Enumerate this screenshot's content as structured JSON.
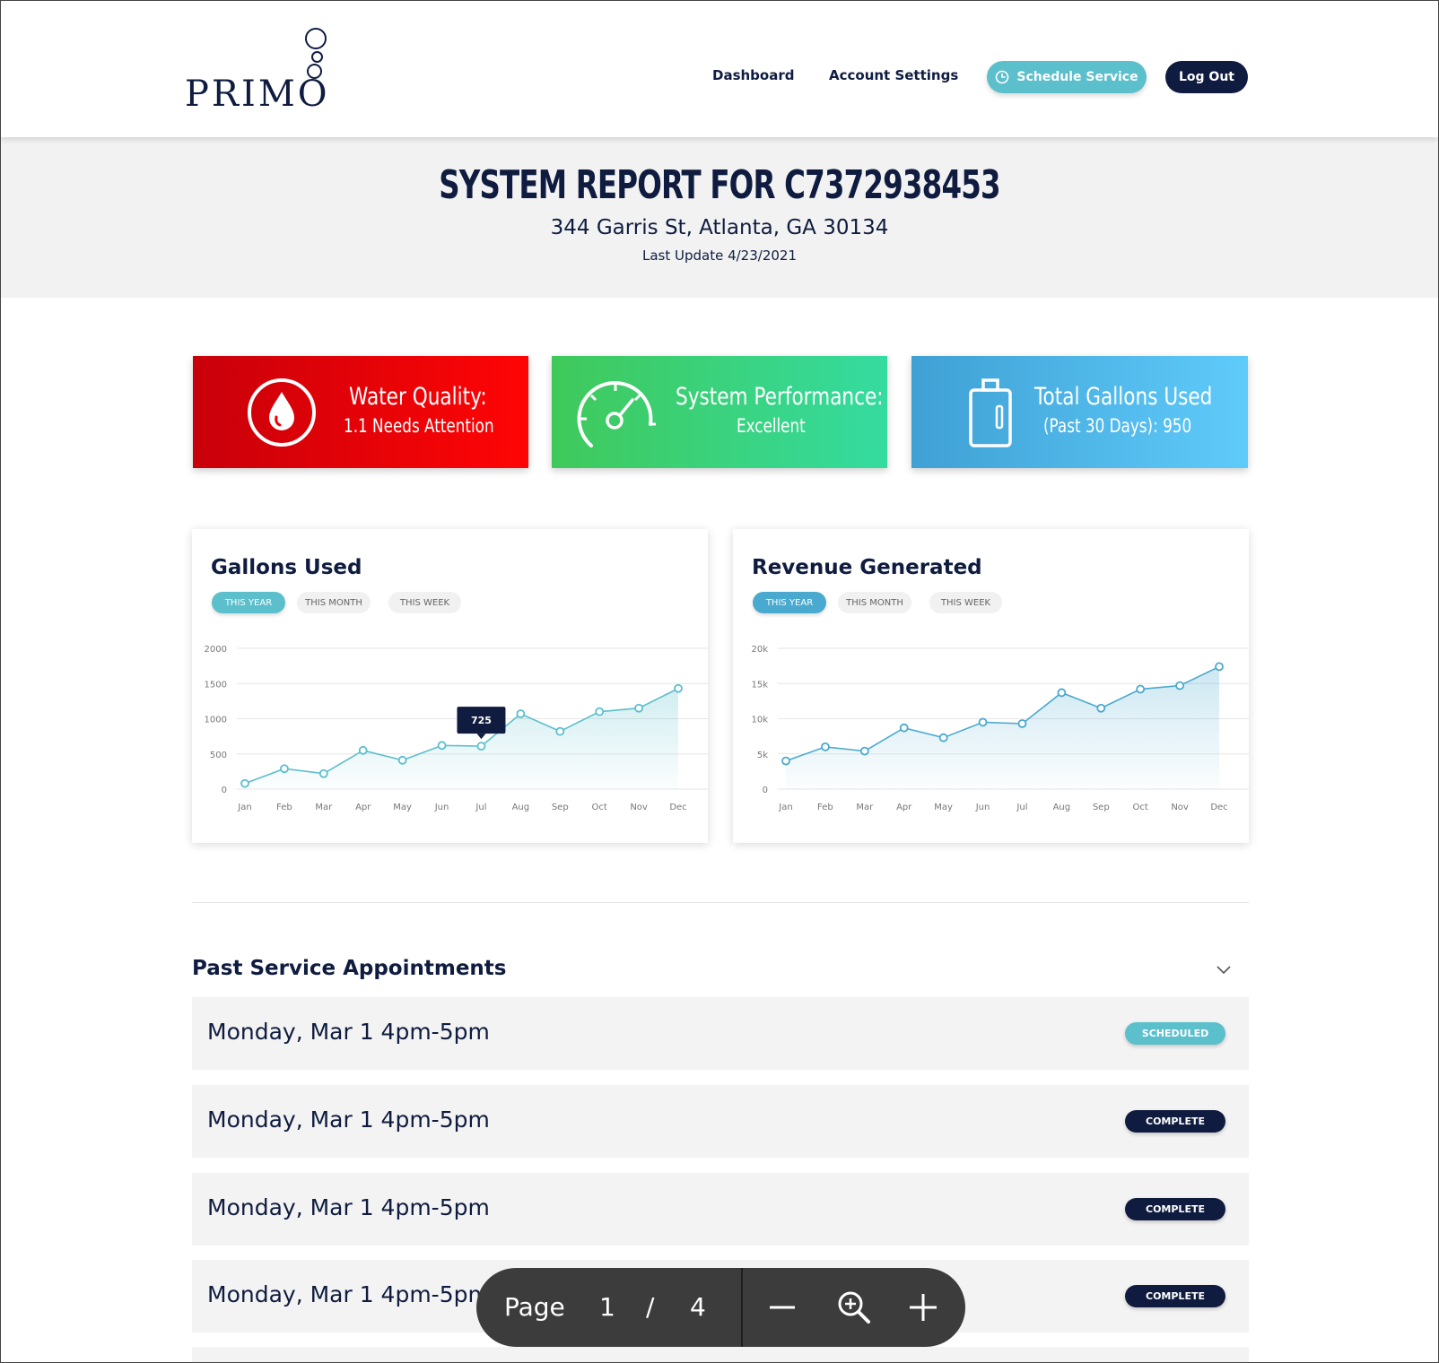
{
  "header": {
    "logo_text": "PRIMO",
    "nav": [
      "Dashboard",
      "Account Settings"
    ],
    "schedule_label": "Schedule Service",
    "logout_label": "Log Out"
  },
  "hero": {
    "title": "SYSTEM REPORT FOR C7372938453",
    "address": "344 Garris St, Atlanta, GA 30134",
    "last_update": "Last Update 4/23/2021"
  },
  "stats": [
    {
      "icon": "water-drop-icon",
      "title": "Water Quality:",
      "value": "1.1 Needs Attention",
      "color_start": "#c8000a",
      "color_end": "#ff0505"
    },
    {
      "icon": "speedometer-icon",
      "title": "System Performance:",
      "value": "Excellent",
      "color_start": "#3fc95a",
      "color_end": "#35dba0"
    },
    {
      "icon": "water-jug-icon",
      "title": "Total Gallons Used",
      "value": "(Past 30 Days): 950",
      "color_start": "#3fa0d4",
      "color_end": "#5fcbfb"
    }
  ],
  "ranges": [
    "THIS YEAR",
    "THIS MONTH",
    "THIS WEEK"
  ],
  "chart_data": [
    {
      "type": "line",
      "title": "Gallons Used",
      "selected_range": "THIS YEAR",
      "categories": [
        "Jan",
        "Feb",
        "Mar",
        "Apr",
        "May",
        "Jun",
        "Jul",
        "Aug",
        "Sep",
        "Oct",
        "Nov",
        "Dec"
      ],
      "values": [
        80,
        290,
        220,
        550,
        410,
        620,
        610,
        1070,
        820,
        1100,
        1150,
        1430
      ],
      "yticks": [
        "0",
        "500",
        "1000",
        "1500",
        "2000"
      ],
      "ylim": [
        0,
        2000
      ],
      "tooltip": {
        "index": 6,
        "label": "725"
      },
      "grid": true,
      "color": "#5bbfcc"
    },
    {
      "type": "line",
      "title": "Revenue Generated",
      "selected_range": "THIS YEAR",
      "categories": [
        "Jan",
        "Feb",
        "Mar",
        "Apr",
        "May",
        "Jun",
        "Jul",
        "Aug",
        "Sep",
        "Oct",
        "Nov",
        "Dec"
      ],
      "values": [
        4000,
        6000,
        5400,
        8700,
        7300,
        9500,
        9300,
        13700,
        11500,
        14200,
        14700,
        17400
      ],
      "yticks": [
        "0",
        "5k",
        "10k",
        "15k",
        "20k"
      ],
      "ylim": [
        0,
        20000
      ],
      "grid": true,
      "color": "#4aa9cf"
    }
  ],
  "appointments": {
    "title": "Past Service Appointments",
    "items": [
      {
        "when": "Monday, Mar 1 4pm-5pm",
        "status": "SCHEDULED"
      },
      {
        "when": "Monday, Mar 1 4pm-5pm",
        "status": "COMPLETE"
      },
      {
        "when": "Monday, Mar 1 4pm-5pm",
        "status": "COMPLETE"
      },
      {
        "when": "Monday, Mar 1 4pm-5pm",
        "status": "COMPLETE"
      }
    ]
  },
  "pdf_toolbar": {
    "page_label": "Page",
    "current_page": "1",
    "separator": "/",
    "total_pages": "4"
  }
}
